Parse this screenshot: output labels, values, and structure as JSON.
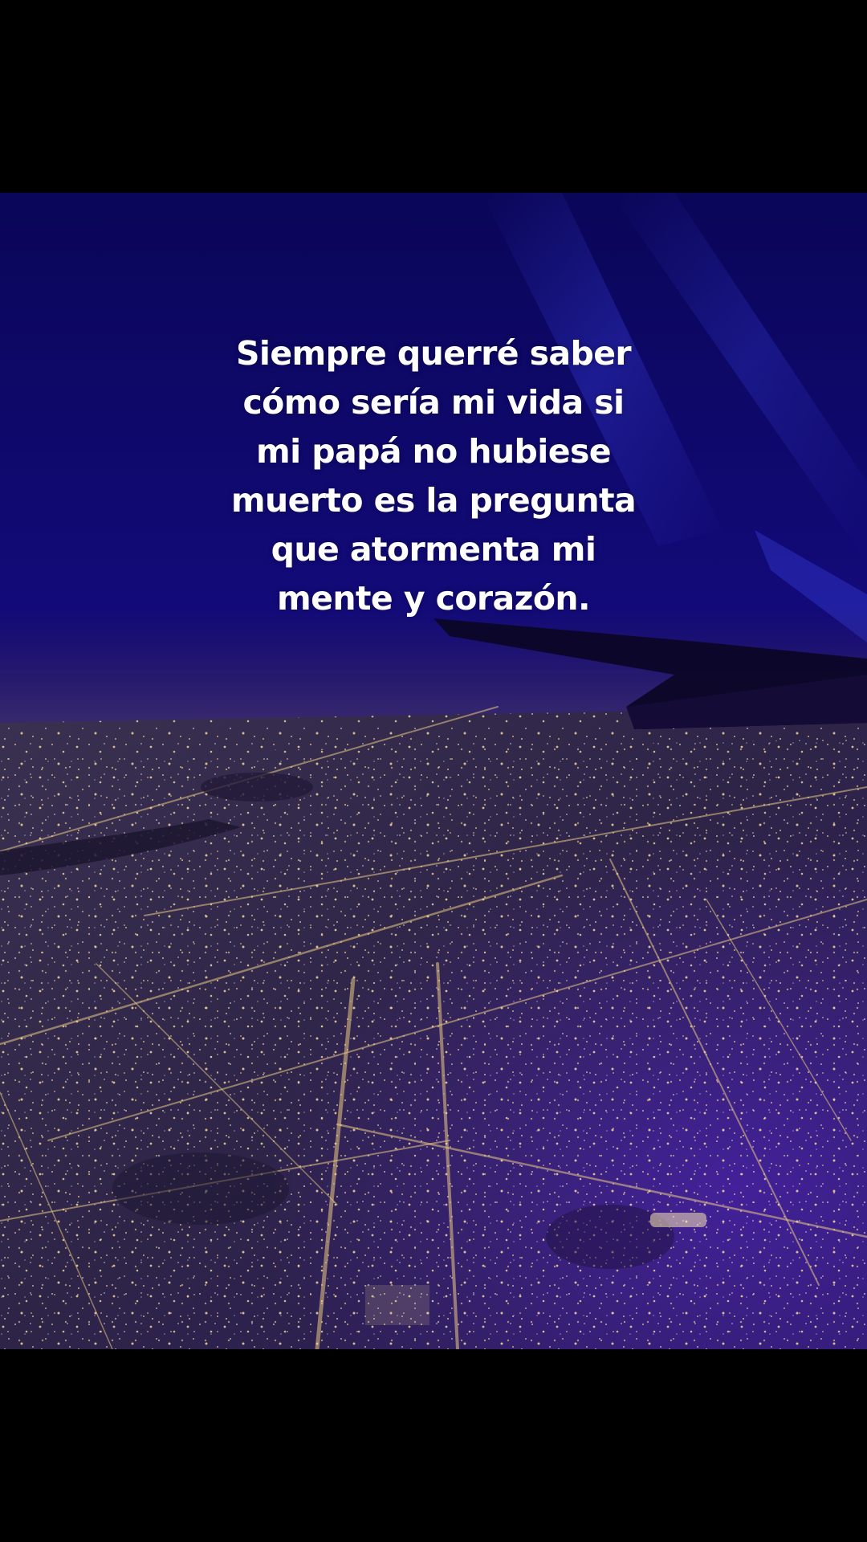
{
  "caption": {
    "lines": [
      "Siempre querré saber",
      "cómo sería mi vida si",
      "mi papá no hubiese",
      "muerto es la pregunta",
      "que atormenta mi",
      "mente y corazón."
    ]
  },
  "colors": {
    "sky_top": "#0b0660",
    "sky_mid": "#1a0f8a",
    "haze": "#3a2a6a",
    "ground": "#2e2548",
    "ground_violet": "#3a1c8c",
    "city_light": "#f3d99a",
    "caption_text": "#ffffff",
    "letterbox": "#000000"
  }
}
